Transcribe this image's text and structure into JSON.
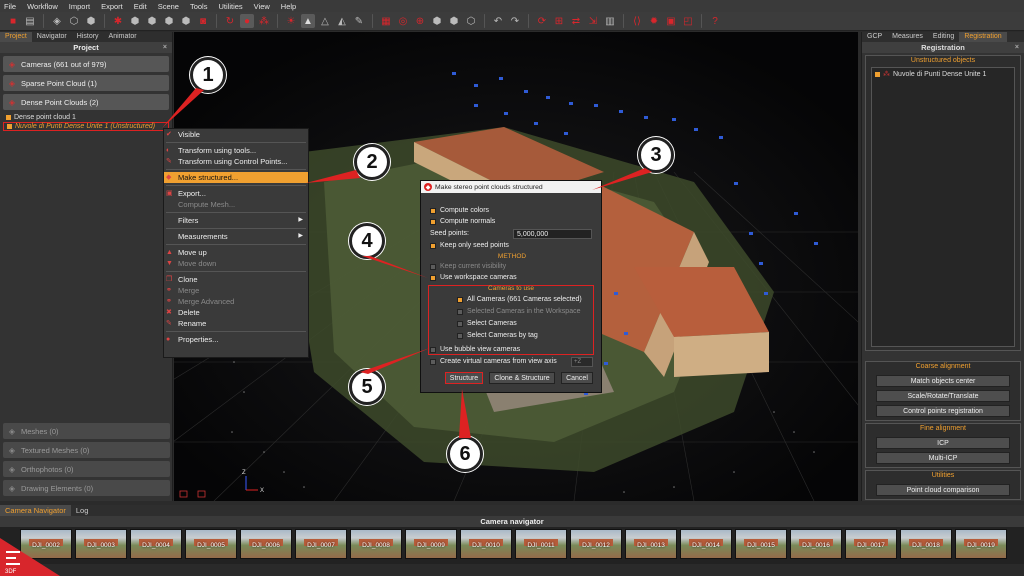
{
  "menu": [
    "File",
    "Workflow",
    "Import",
    "Export",
    "Edit",
    "Scene",
    "Tools",
    "Utilities",
    "View",
    "Help"
  ],
  "left_tabs": [
    {
      "label": "Project",
      "active": true
    },
    {
      "label": "Navigator",
      "active": false
    },
    {
      "label": "History",
      "active": false
    },
    {
      "label": "Animator",
      "active": false
    }
  ],
  "left_panel": {
    "title": "Project",
    "close": "×",
    "groups_top": [
      {
        "label": "Cameras (661 out of 979)",
        "icon": "camera-icon"
      },
      {
        "label": "Sparse Point Cloud (1)",
        "icon": "sparse-cloud-icon"
      },
      {
        "label": "Dense Point Clouds (2)",
        "icon": "dense-cloud-icon"
      }
    ],
    "tree": [
      {
        "label": "Dense point cloud 1",
        "selected": false
      },
      {
        "label": "Nuvole di Punti Dense Unite 1 (Unstructured)",
        "selected": true
      }
    ],
    "groups_bottom": [
      {
        "label": "Meshes (0)"
      },
      {
        "label": "Textured Meshes (0)"
      },
      {
        "label": "Orthophotos (0)"
      },
      {
        "label": "Drawing Elements (0)"
      }
    ]
  },
  "context_menu": {
    "items": [
      {
        "label": "Visible",
        "icon": "✔",
        "disabled": false
      },
      {
        "sep": true
      },
      {
        "label": "Transform using tools...",
        "icon": "◐",
        "disabled": false
      },
      {
        "label": "Transform using Control Points...",
        "icon": "✎",
        "disabled": false
      },
      {
        "sep": true
      },
      {
        "label": "Make structured...",
        "icon": "◆",
        "disabled": false,
        "highlight": true
      },
      {
        "sep": true
      },
      {
        "label": "Export...",
        "icon": "▣",
        "disabled": false
      },
      {
        "label": "Compute Mesh...",
        "icon": "",
        "disabled": true
      },
      {
        "sep": true
      },
      {
        "label": "Filters",
        "icon": "",
        "disabled": false,
        "submenu": true
      },
      {
        "sep": true
      },
      {
        "label": "Measurements",
        "icon": "",
        "disabled": false,
        "submenu": true
      },
      {
        "sep": true
      },
      {
        "label": "Move up",
        "icon": "▲",
        "disabled": false
      },
      {
        "label": "Move down",
        "icon": "▼",
        "disabled": true
      },
      {
        "sep": true
      },
      {
        "label": "Clone",
        "icon": "❐",
        "disabled": false
      },
      {
        "label": "Merge",
        "icon": "⚭",
        "disabled": true
      },
      {
        "label": "Merge Advanced",
        "icon": "⚭",
        "disabled": true
      },
      {
        "label": "Delete",
        "icon": "✖",
        "disabled": false
      },
      {
        "label": "Rename",
        "icon": "✎",
        "disabled": false
      },
      {
        "sep": true
      },
      {
        "label": "Properties...",
        "icon": "●",
        "disabled": false
      }
    ]
  },
  "dialog": {
    "title": "Make stereo point clouds structured",
    "compute_colors": "Compute colors",
    "compute_normals": "Compute normals",
    "seed_points_label": "Seed points:",
    "seed_points_value": "5,000,000",
    "keep_only_seed": "Keep only seed points",
    "method_title": "METHOD",
    "keep_current_visibility": "Keep current visibility",
    "use_workspace_cameras": "Use workspace cameras",
    "cameras_to_use_title": "Cameras to use",
    "radio_all": "All Cameras (661 Cameras selected)",
    "radio_in_workspace": "Selected Cameras in the Workspace",
    "radio_select": "Select Cameras",
    "radio_by_tag": "Select Cameras by tag",
    "use_bubble": "Use bubble view cameras",
    "create_virtual": "Create virtual cameras from view axis",
    "virtual_axis": "+Z",
    "btn_structure": "Structure",
    "btn_clone_structure": "Clone & Structure",
    "btn_cancel": "Cancel"
  },
  "right_tabs": [
    {
      "label": "GCP",
      "active": false
    },
    {
      "label": "Measures",
      "active": false
    },
    {
      "label": "Editing",
      "active": false
    },
    {
      "label": "Registration",
      "active": true
    }
  ],
  "right_panel": {
    "title": "Registration",
    "close": "×",
    "unstructured_title": "Unstructured objects",
    "unstructured_item": "Nuvole di Punti Dense Unite 1",
    "coarse_title": "Coarse alignment",
    "coarse_buttons": [
      "Match objects center",
      "Scale/Rotate/Translate",
      "Control points registration"
    ],
    "fine_title": "Fine alignment",
    "fine_buttons": [
      "ICP",
      "Multi-ICP"
    ],
    "utilities_title": "Utilities",
    "utilities_buttons": [
      "Point cloud comparison"
    ]
  },
  "bottom_tabs": [
    {
      "label": "Camera Navigator",
      "active": true
    },
    {
      "label": "Log",
      "active": false
    }
  ],
  "camera_navigator": {
    "title": "Camera navigator",
    "thumbs": [
      "DJI_0002",
      "DJI_0003",
      "DJI_0004",
      "DJI_0005",
      "DJI_0006",
      "DJI_0007",
      "DJI_0008",
      "DJI_0009",
      "DJI_0010",
      "DJI_0011",
      "DJI_0012",
      "DJI_0013",
      "DJI_0014",
      "DJI_0015",
      "DJI_0016",
      "DJI_0017",
      "DJI_0018",
      "DJI_0019"
    ]
  },
  "callouts": [
    "1",
    "2",
    "3",
    "4",
    "5",
    "6"
  ],
  "logo_text": "3DF",
  "colors": {
    "accent": "#f0a030",
    "brand_red": "#d8262c",
    "panel": "#333333"
  }
}
